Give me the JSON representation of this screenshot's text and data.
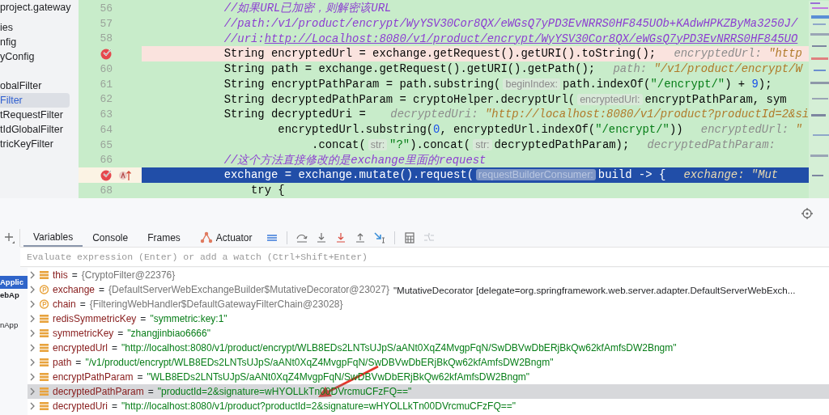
{
  "project_tree": {
    "items": [
      {
        "label": "project.gateway",
        "selected": false
      },
      {
        "label": "ies",
        "selected": false
      },
      {
        "label": "nfig",
        "selected": false
      },
      {
        "label": "yConfig",
        "selected": false
      },
      {
        "label": "obalFilter",
        "selected": false
      },
      {
        "label": "Filter",
        "selected": true
      },
      {
        "label": "tRequestFilter",
        "selected": false
      },
      {
        "label": "tIdGlobalFilter",
        "selected": false
      },
      {
        "label": "tricKeyFilter",
        "selected": false
      }
    ]
  },
  "editor": {
    "lines": [
      {
        "number": "56",
        "breakpoint": false,
        "execution_point": false,
        "segments": [
          {
            "text": "        //如果URL已加密，则解密该URL",
            "kind": "comment"
          }
        ]
      },
      {
        "number": "57",
        "breakpoint": false,
        "execution_point": false,
        "segments": [
          {
            "text": "        //path:/v1/product/encrypt/WyYSV30Cor8QX/eWGsQ7yPD3EvNRRS0HF845UOb+KAdwHPKZByMa3250J/",
            "kind": "comment"
          }
        ]
      },
      {
        "number": "58",
        "breakpoint": false,
        "execution_point": false,
        "segments": [
          {
            "text": "        //uri:",
            "kind": "comment"
          },
          {
            "text": "http://Localhost:8080/v1/product/encrypt/WyYSV30Cor8QX/eWGsQ7yPD3EvNRRS0HF845UO",
            "kind": "comment-link"
          }
        ]
      },
      {
        "breakpoint": true,
        "execution_point": false,
        "segments": [
          {
            "text": "        String encryptedUrl = exchange.getRequest().getURI().toString();",
            "kind": "code"
          },
          {
            "text": "encryptedUrl:",
            "kind": "label"
          },
          {
            "text": "\"http",
            "kind": "value"
          }
        ]
      },
      {
        "number": "60",
        "breakpoint": false,
        "execution_point": false,
        "segments": [
          {
            "text": "        String path = exchange.getRequest().getURI().getPath();",
            "kind": "code"
          },
          {
            "text": "path:",
            "kind": "label"
          },
          {
            "text": "\"/v1/product/encrypt/W",
            "kind": "value"
          }
        ]
      },
      {
        "number": "61",
        "breakpoint": false,
        "execution_point": false,
        "segments": [
          {
            "text": "        String encryptPathParam = path.substring(",
            "kind": "code"
          },
          {
            "text": "beginIndex:",
            "kind": "inlay"
          },
          {
            "text": "path.indexOf(",
            "kind": "code"
          },
          {
            "text": "\"/encrypt/\"",
            "kind": "string"
          },
          {
            "text": ") + ",
            "kind": "code"
          },
          {
            "text": "9",
            "kind": "number"
          },
          {
            "text": ");",
            "kind": "code"
          }
        ]
      },
      {
        "number": "62",
        "breakpoint": false,
        "execution_point": false,
        "segments": [
          {
            "text": "        String decryptedPathParam = cryptoHelper.decryptUrl(",
            "kind": "code"
          },
          {
            "text": "encryptedUrl:",
            "kind": "inlay"
          },
          {
            "text": "encryptPathParam, sym",
            "kind": "code"
          }
        ]
      },
      {
        "number": "63",
        "breakpoint": false,
        "execution_point": false,
        "segments": [
          {
            "text": "        String decryptedUri = ",
            "kind": "code"
          },
          {
            "text": "decryptedUri:",
            "kind": "label"
          },
          {
            "text": "\"http://localhost:8080/v1/product?productId=2&si",
            "kind": "value"
          }
        ]
      },
      {
        "number": "64",
        "breakpoint": false,
        "execution_point": false,
        "segments": [
          {
            "text": "                encryptedUrl.substring(",
            "kind": "code"
          },
          {
            "text": "0",
            "kind": "number"
          },
          {
            "text": ", encryptedUrl.indexOf(",
            "kind": "code"
          },
          {
            "text": "\"/encrypt/\"",
            "kind": "string"
          },
          {
            "text": "))",
            "kind": "code"
          },
          {
            "text": "encryptedUrl:",
            "kind": "label"
          },
          {
            "text": "\"",
            "kind": "value"
          }
        ]
      },
      {
        "number": "65",
        "breakpoint": false,
        "execution_point": false,
        "segments": [
          {
            "text": "                     .concat(",
            "kind": "code"
          },
          {
            "text": "str:",
            "kind": "inlay"
          },
          {
            "text": "\"?\"",
            "kind": "string"
          },
          {
            "text": ").concat(",
            "kind": "code"
          },
          {
            "text": "str:",
            "kind": "inlay"
          },
          {
            "text": "decryptedPathParam);",
            "kind": "code"
          },
          {
            "text": "decryptedPathParam:",
            "kind": "label"
          }
        ]
      },
      {
        "number": "66",
        "breakpoint": false,
        "execution_point": false,
        "segments": [
          {
            "text": "        //这个方法直接修改的是exchange里面的request",
            "kind": "comment"
          }
        ]
      },
      {
        "breakpoint": true,
        "execution_point": true,
        "segments": [
          {
            "text": "        exchange = exchange.mutate().request(",
            "kind": "code"
          },
          {
            "text": "requestBuilderConsumer:",
            "kind": "inlay"
          },
          {
            "text": "build -> {",
            "kind": "code"
          },
          {
            "text": "exchange:",
            "kind": "label"
          },
          {
            "text": "\"Mut",
            "kind": "value"
          }
        ]
      },
      {
        "number": "68",
        "breakpoint": false,
        "execution_point": false,
        "segments": [
          {
            "text": "            try {",
            "kind": "code"
          }
        ]
      }
    ]
  },
  "debugger": {
    "tabs": [
      {
        "label": "Variables",
        "kind": "text",
        "selected": true
      },
      {
        "label": "Console",
        "kind": "text",
        "selected": false
      },
      {
        "label": "Frames",
        "kind": "text",
        "selected": false
      },
      {
        "label": "Actuator",
        "kind": "actuator",
        "selected": false
      }
    ],
    "toolbar": [
      {
        "kind": "layout",
        "disabled": false
      },
      {
        "kind": "step-over",
        "disabled": false
      },
      {
        "kind": "step-into",
        "disabled": false
      },
      {
        "kind": "force-step-into",
        "disabled": false
      },
      {
        "kind": "step-out",
        "disabled": false
      },
      {
        "kind": "run-to-cursor",
        "disabled": false
      },
      {
        "kind": "evaluate",
        "disabled": false
      },
      {
        "kind": "trace",
        "disabled": true
      }
    ],
    "evaluate": {
      "placeholder": "Evaluate expression (Enter) or add a watch (Ctrl+Shift+Enter)"
    },
    "services": [
      {
        "label": "Applic",
        "bold": true,
        "selected": true
      },
      {
        "label": "ebAp",
        "bold": true,
        "selected": false
      },
      {
        "label": "nApp",
        "bold": false,
        "selected": false
      }
    ],
    "variables": [
      {
        "name": "this",
        "kind": "field",
        "separator": "=",
        "value": "{CryptoFilter@22376}",
        "color": "#767676",
        "selected": false
      },
      {
        "name": "exchange",
        "kind": "parameter",
        "separator": "=",
        "value": "{DefaultServerWebExchangeBuilder$MutativeDecorator@23027}",
        "color": "#767676",
        "detail": "\"MutativeDecorator [delegate=org.springframework.web.server.adapter.DefaultServerWebExch...",
        "selected": false
      },
      {
        "name": "chain",
        "kind": "parameter",
        "separator": "=",
        "value": "{FilteringWebHandler$DefaultGatewayFilterChain@23028}",
        "color": "#767676",
        "selected": false
      },
      {
        "name": "redisSymmetricKey",
        "kind": "field",
        "separator": "=",
        "value": "\"symmetric:key:1\"",
        "color": "#067d17",
        "selected": false
      },
      {
        "name": "symmetricKey",
        "kind": "field",
        "separator": "=",
        "value": "\"zhangjinbiao6666\"",
        "color": "#067d17",
        "selected": false
      },
      {
        "name": "encryptedUrl",
        "kind": "field",
        "separator": "=",
        "value": "\"http://localhost:8080/v1/product/encrypt/WLB8EDs2LNTsUJpS/aANt0XqZ4MvgpFqN/SwDBVwDbERjBkQw62kfAmfsDW2Bngm\"",
        "color": "#067d17",
        "selected": false
      },
      {
        "name": "path",
        "kind": "field",
        "separator": "=",
        "value": "\"/v1/product/encrypt/WLB8EDs2LNTsUJpS/aANt0XqZ4MvgpFqN/SwDBVwDbERjBkQw62kfAmfsDW2Bngm\"",
        "color": "#067d17",
        "selected": false
      },
      {
        "name": "encryptPathParam",
        "kind": "field",
        "separator": "=",
        "value": "\"WLB8EDs2LNTsUJpS/aANt0XqZ4MvgpFqN/SwDBVwDbERjBkQw62kfAmfsDW2Bngm\"",
        "color": "#067d17",
        "selected": false
      },
      {
        "name": "decryptedPathParam",
        "kind": "field",
        "separator": "=",
        "value": "\"productId=2&signature=wHYOLLkTn00DVrcmuCFzFQ==\"",
        "color": "#067d17",
        "selected": true
      },
      {
        "name": "decryptedUri",
        "kind": "field",
        "separator": "=",
        "value": "\"http://localhost:8080/v1/product?productId=2&signature=wHYOLLkTn00DVrcmuCFzFQ==\"",
        "color": "#067d17",
        "selected": false
      }
    ]
  }
}
